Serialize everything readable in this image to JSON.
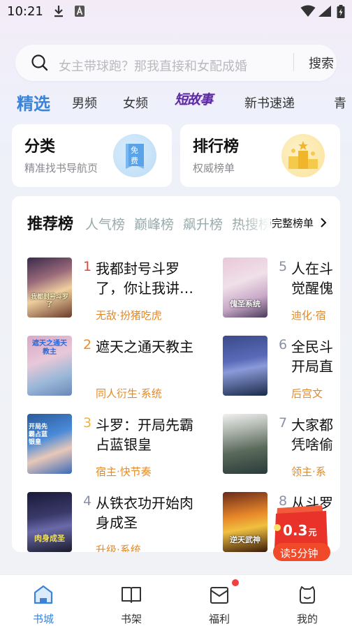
{
  "status_bar": {
    "time": "10:21"
  },
  "search": {
    "placeholder": "女主带球跑？那我直接和女配成婚",
    "button_label": "搜索"
  },
  "tabs": [
    {
      "label": "精选"
    },
    {
      "label": "男频"
    },
    {
      "label": "女频"
    },
    {
      "label": "短故事"
    },
    {
      "label": "新书速递"
    },
    {
      "label": "青"
    }
  ],
  "cards": {
    "category": {
      "title": "分类",
      "subtitle": "精准找书导航页",
      "icon_text": "免费"
    },
    "ranking": {
      "title": "排行榜",
      "subtitle": "权威榜单"
    }
  },
  "ranking_panel": {
    "title": "推荐榜",
    "tabs": [
      "人气榜",
      "巅峰榜",
      "飙升榜",
      "热搜榜"
    ],
    "full_list_label": "完整榜单",
    "books": [
      {
        "rank": "1",
        "title": "我都封号斗罗了，你让我讲…",
        "tags": "无敌·扮猪吃虎",
        "cover_text": "我都封号斗罗了"
      },
      {
        "rank": "2",
        "title": "遮天之通天教主",
        "tags": "同人衍生·系统",
        "cover_text": "遮天之通天教主"
      },
      {
        "rank": "3",
        "title": "斗罗：开局先霸占蓝银皇",
        "tags": "宿主·快节奏",
        "cover_text": "开局先霸占蓝银皇"
      },
      {
        "rank": "4",
        "title": "从铁衣功开始肉身成圣",
        "tags": "升级·系统",
        "cover_text": "肉身成圣"
      },
      {
        "rank": "5",
        "title": "人在斗觉醒傀",
        "tags": "迪化·宿",
        "cover_text": "傀圣系统"
      },
      {
        "rank": "6",
        "title": "全民斗开局直",
        "tags": "后宫文",
        "cover_text": ""
      },
      {
        "rank": "7",
        "title": "大家都凭啥偷",
        "tags": "领主·系",
        "cover_text": ""
      },
      {
        "rank": "8",
        "title": "从斗罗",
        "tags": "",
        "cover_text": "逆天武神"
      }
    ]
  },
  "promo": {
    "amount": "0.3",
    "unit": "元",
    "label": "读5分钟"
  },
  "bottom_nav": [
    {
      "label": "书城",
      "active": true
    },
    {
      "label": "书架",
      "active": false
    },
    {
      "label": "福利",
      "active": false
    },
    {
      "label": "我的",
      "active": false
    }
  ],
  "colors": {
    "accent": "#3a83d8",
    "tag": "#e08a2a",
    "rank1": "#e8433a",
    "rank2": "#ef8c2a",
    "rank3": "#f0b23a",
    "rank_other": "#8a8fa8"
  }
}
